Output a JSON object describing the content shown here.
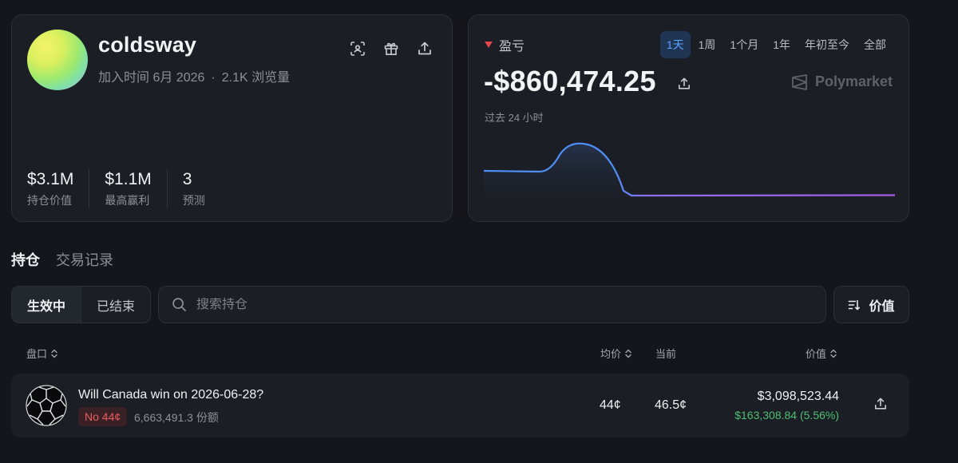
{
  "profile": {
    "username": "coldsway",
    "joined": "加入时间 6月 2026",
    "separator": "·",
    "views": "2.1K 浏览量",
    "icons": [
      "scan-icon",
      "gift-icon",
      "share-icon"
    ],
    "stats": [
      {
        "value": "$3.1M",
        "label": "持仓价值"
      },
      {
        "value": "$1.1M",
        "label": "最高赢利"
      },
      {
        "value": "3",
        "label": "预测"
      }
    ]
  },
  "pnl": {
    "label": "盈亏",
    "value": "-$860,474.25",
    "brand": "Polymarket",
    "period": "过去 24 小时",
    "ranges": [
      "1天",
      "1周",
      "1个月",
      "1年",
      "年初至今",
      "全部"
    ],
    "active_range": "1天",
    "colors": {
      "negative": "#e2484d",
      "line_start": "#4f8ff7",
      "line_end": "#a35de8"
    }
  },
  "tabs": {
    "positions": "持仓",
    "history": "交易记录"
  },
  "filters": {
    "active_label": "生效中",
    "closed_label": "已结束",
    "search_placeholder": "搜索持仓",
    "sort_label": "价值"
  },
  "table": {
    "headers": {
      "market": "盘口",
      "avg": "均价",
      "current": "当前",
      "value": "价值"
    },
    "rows": [
      {
        "title": "Will Canada win on 2026-06-28?",
        "outcome": "No 44¢",
        "shares": "6,663,491.3 份额",
        "avg": "44¢",
        "current": "46.5¢",
        "value": "$3,098,523.44",
        "pnl": "$163,308.84 (5.56%)",
        "icon": "soccer-ball-icon"
      }
    ]
  }
}
